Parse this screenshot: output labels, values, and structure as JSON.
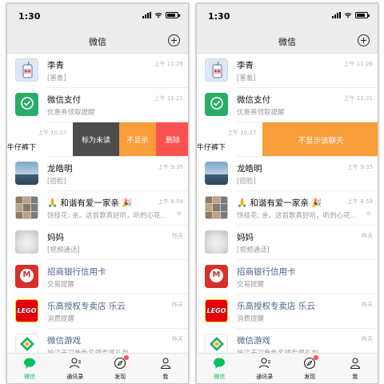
{
  "colors": {
    "accent_green": "#07c160",
    "swipe_orange": "#fa9d3b",
    "swipe_dark": "#4c4c4c",
    "swipe_red": "#fa5151",
    "nav_bg": "#ededed"
  },
  "status": {
    "time": "1:30"
  },
  "nav": {
    "title": "微信",
    "plus_icon": "plus-circle-icon"
  },
  "chats": [
    {
      "name": "李青",
      "message": "[害羞]",
      "time": "上午 11:26",
      "avatar": "cartoon-drink"
    },
    {
      "name": "微信支付",
      "message": "优惠券领取提醒",
      "time": "上午 11:21",
      "avatar": "wechat-pay-logo"
    },
    {
      "name": "",
      "message": "牛仔裤下",
      "time": "上午 10:27"
    },
    {
      "name": "龙皓明",
      "message": "[捂脸]",
      "time": "上午 9:35",
      "avatar": "landscape-photo"
    },
    {
      "name": "🙏 和谐有爱一家亲 🎉",
      "message": "饶桂花: 亲。这首歌真好听，听的心花...",
      "time": "上午 8:59",
      "avatar": "group-grid"
    },
    {
      "name": "妈妈",
      "message": "[视频通话]",
      "time": "昨天",
      "avatar": "white-cat"
    },
    {
      "name": "招商银行信用卡",
      "message": "交易提醒",
      "time": "",
      "avatar": "cmb-logo"
    },
    {
      "name": "乐高授权专卖店 乐云",
      "message": "消费提醒",
      "time": "昨天",
      "avatar": "lego-logo"
    },
    {
      "name": "微信游戏",
      "message": "抢注天刀角色名领专属礼包",
      "time": "昨天",
      "avatar": "game-logo"
    }
  ],
  "swipe_actions_left": {
    "mark_unread": "标为未读",
    "hide": "不显示",
    "delete": "删除"
  },
  "swipe_actions_right": {
    "confirm_hide": "不显示该聊天"
  },
  "tabs": [
    {
      "label": "微信",
      "icon": "chat-bubble-icon",
      "active": true
    },
    {
      "label": "通讯录",
      "icon": "contacts-icon",
      "active": false
    },
    {
      "label": "发现",
      "icon": "compass-icon",
      "active": false,
      "badge": true
    },
    {
      "label": "我",
      "icon": "person-icon",
      "active": false
    }
  ]
}
